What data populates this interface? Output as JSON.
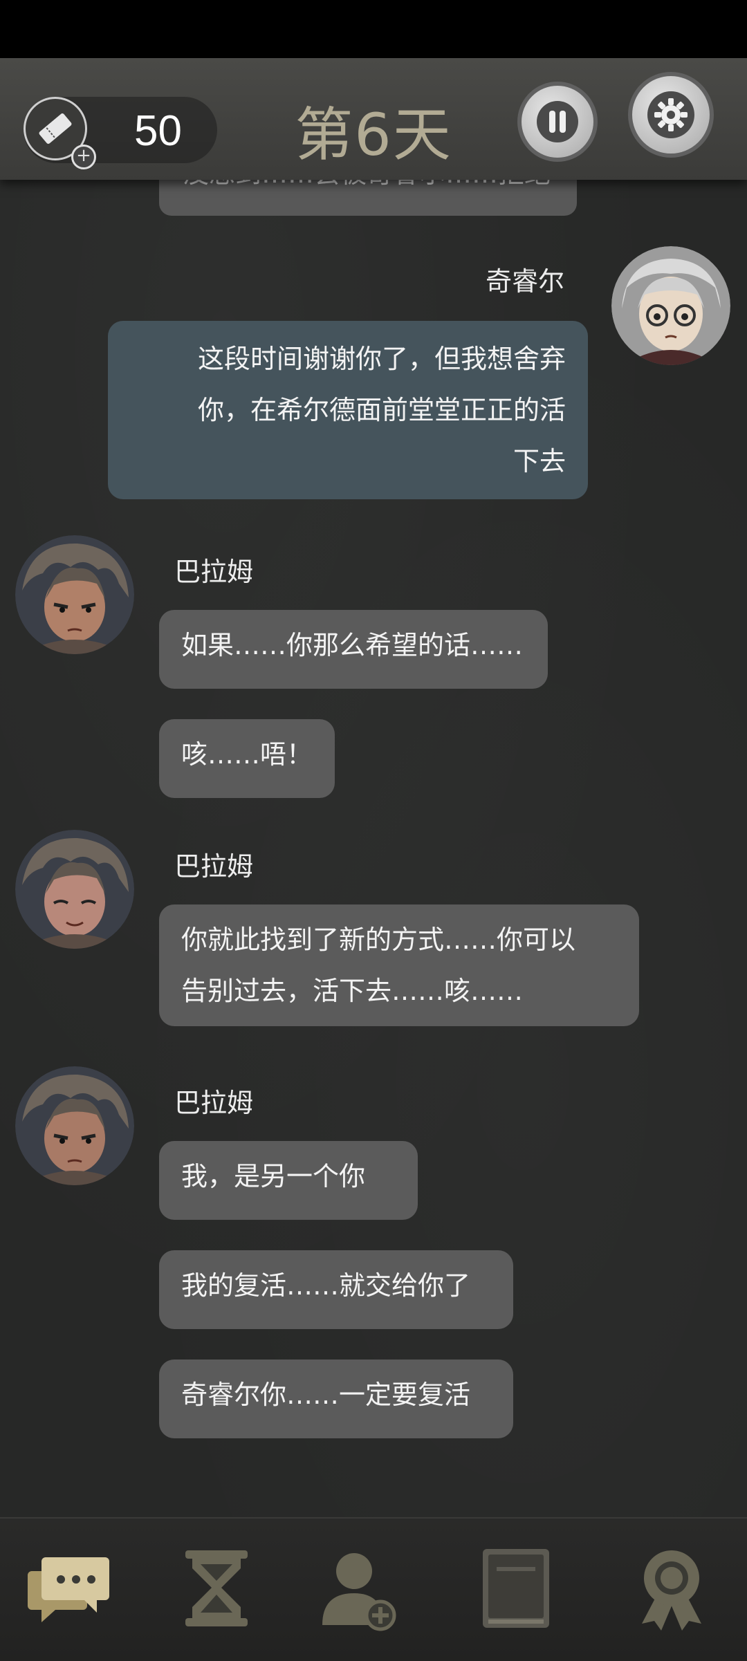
{
  "header": {
    "currency_value": "50",
    "day_title": "第6天",
    "icons": [
      "ticket-icon",
      "plus-icon",
      "pause-icon",
      "gear-icon"
    ]
  },
  "chat": {
    "previous_bubble_text": "没想到……会被奇睿尔……拒绝",
    "messages": [
      {
        "speaker": "奇睿尔",
        "text_lines": [
          "这段时间谢谢你了，但我想舍弃",
          "你，在希尔德面前堂堂正正的活",
          "下去"
        ]
      },
      {
        "speaker": "巴拉姆",
        "texts": [
          "如果……你那么希望的话……",
          "咳……唔！"
        ]
      },
      {
        "speaker": "巴拉姆",
        "text_lines": [
          "你就此找到了新的方式……你可以",
          "告别过去，活下去……咳……"
        ]
      },
      {
        "speaker": "巴拉姆",
        "texts": [
          "我，是另一个你",
          "我的复活……就交给你了",
          "奇睿尔你……一定要复活"
        ]
      }
    ]
  },
  "bottom_nav": {
    "items": [
      "chat-icon",
      "hourglass-icon",
      "add-person-icon",
      "book-icon",
      "medal-icon"
    ],
    "active": "chat-icon"
  },
  "colors": {
    "background": "#272827",
    "other_bubble": "#5b5b5b",
    "my_bubble": "#45545c",
    "day_title": "#b2ab94",
    "nav_active": "#d7c9a0",
    "nav_inactive": "#6a6756"
  }
}
